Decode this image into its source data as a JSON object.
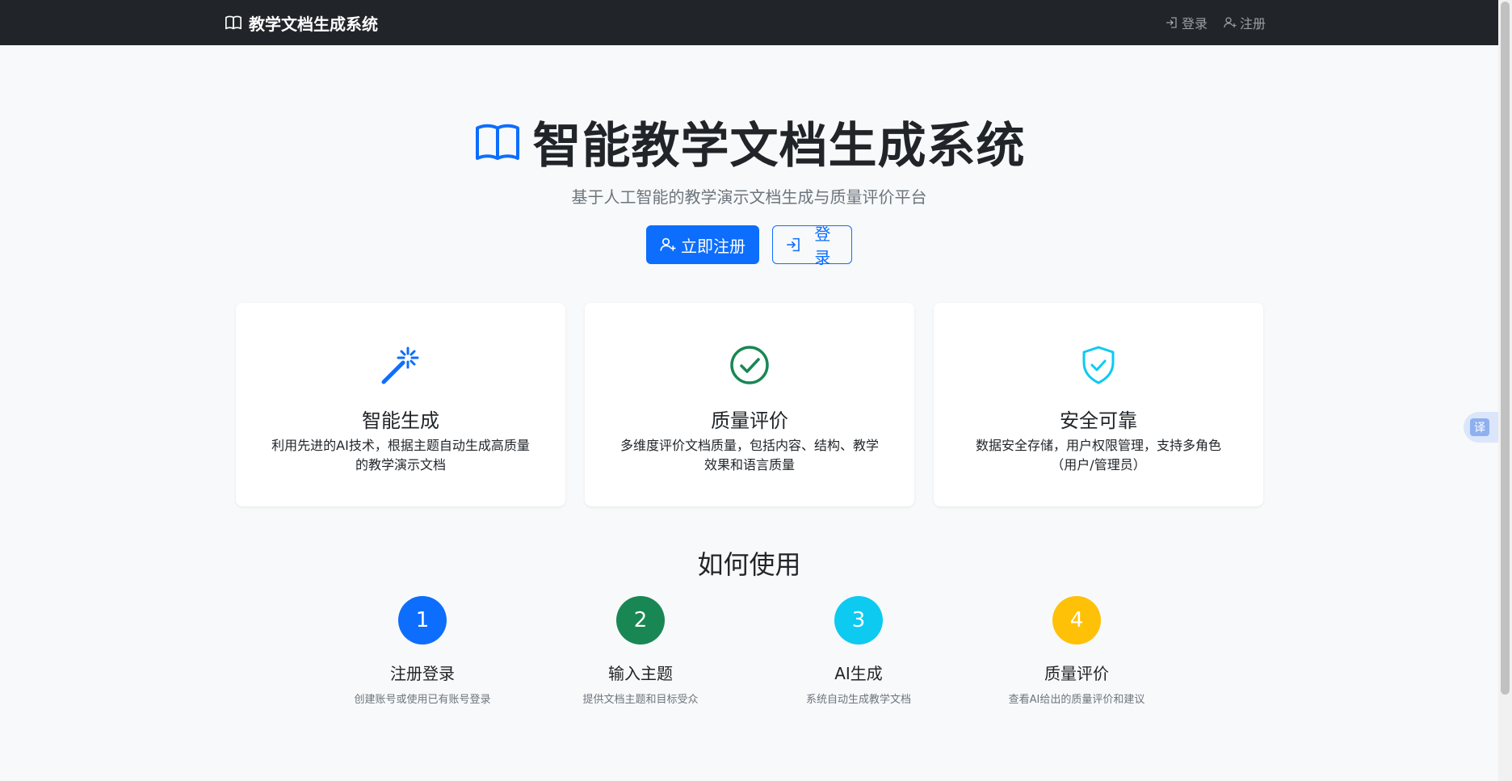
{
  "nav": {
    "brand": "教学文档生成系统",
    "login": "登录",
    "register": "注册"
  },
  "hero": {
    "title": "智能教学文档生成系统",
    "subtitle": "基于人工智能的教学演示文档生成与质量评价平台",
    "register_btn": "立即注册",
    "login_btn": "登录"
  },
  "features": [
    {
      "title": "智能生成",
      "desc": "利用先进的AI技术，根据主题自动生成高质量的教学演示文档",
      "icon": "magic-wand-icon",
      "color": "#0d6efd"
    },
    {
      "title": "质量评价",
      "desc": "多维度评价文档质量，包括内容、结构、教学效果和语言质量",
      "icon": "check-circle-icon",
      "color": "#198754"
    },
    {
      "title": "安全可靠",
      "desc": "数据安全存储，用户权限管理，支持多角色（用户/管理员）",
      "icon": "shield-check-icon",
      "color": "#0dcaf0"
    }
  ],
  "how": {
    "title": "如何使用",
    "steps": [
      {
        "num": "1",
        "title": "注册登录",
        "desc": "创建账号或使用已有账号登录",
        "color": "#0d6efd"
      },
      {
        "num": "2",
        "title": "输入主题",
        "desc": "提供文档主题和目标受众",
        "color": "#198754"
      },
      {
        "num": "3",
        "title": "AI生成",
        "desc": "系统自动生成教学文档",
        "color": "#0dcaf0"
      },
      {
        "num": "4",
        "title": "质量评价",
        "desc": "查看AI给出的质量评价和建议",
        "color": "#ffc107"
      }
    ]
  },
  "translate_badge": "译"
}
